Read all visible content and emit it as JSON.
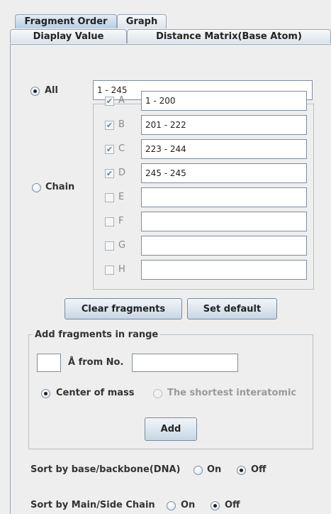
{
  "tabs": {
    "row1": [
      "Fragment Order",
      "Graph"
    ],
    "row2": [
      "Diaplay Value",
      "Distance Matrix(Base Atom)"
    ]
  },
  "all": {
    "label": "All",
    "value": "1 - 245",
    "selected": true
  },
  "chain": {
    "label": "Chain",
    "selected": false,
    "items": [
      {
        "letter": "A",
        "checked": true,
        "value": "1 - 200"
      },
      {
        "letter": "B",
        "checked": true,
        "value": "201 - 222"
      },
      {
        "letter": "C",
        "checked": true,
        "value": "223 - 244"
      },
      {
        "letter": "D",
        "checked": true,
        "value": "245 - 245"
      },
      {
        "letter": "E",
        "checked": false,
        "value": ""
      },
      {
        "letter": "F",
        "checked": false,
        "value": ""
      },
      {
        "letter": "G",
        "checked": false,
        "value": ""
      },
      {
        "letter": "H",
        "checked": false,
        "value": ""
      }
    ]
  },
  "buttons": {
    "clear": "Clear fragments",
    "set_default": "Set default",
    "add": "Add"
  },
  "add_range": {
    "title": "Add fragments in range",
    "angstrom_value": "",
    "from_label": "Å  from No.",
    "from_value": "",
    "center_of_mass": "Center of mass",
    "shortest": "The shortest interatomic"
  },
  "sort_base": {
    "label": "Sort by base/backbone(DNA)",
    "on": "On",
    "off": "Off"
  },
  "sort_main": {
    "label": "Sort by Main/Side Chain",
    "on": "On",
    "off": "Off"
  },
  "colors": {
    "accent": "#b8cfe5",
    "border": "#9aa6b2",
    "background": "#eeeeee"
  }
}
